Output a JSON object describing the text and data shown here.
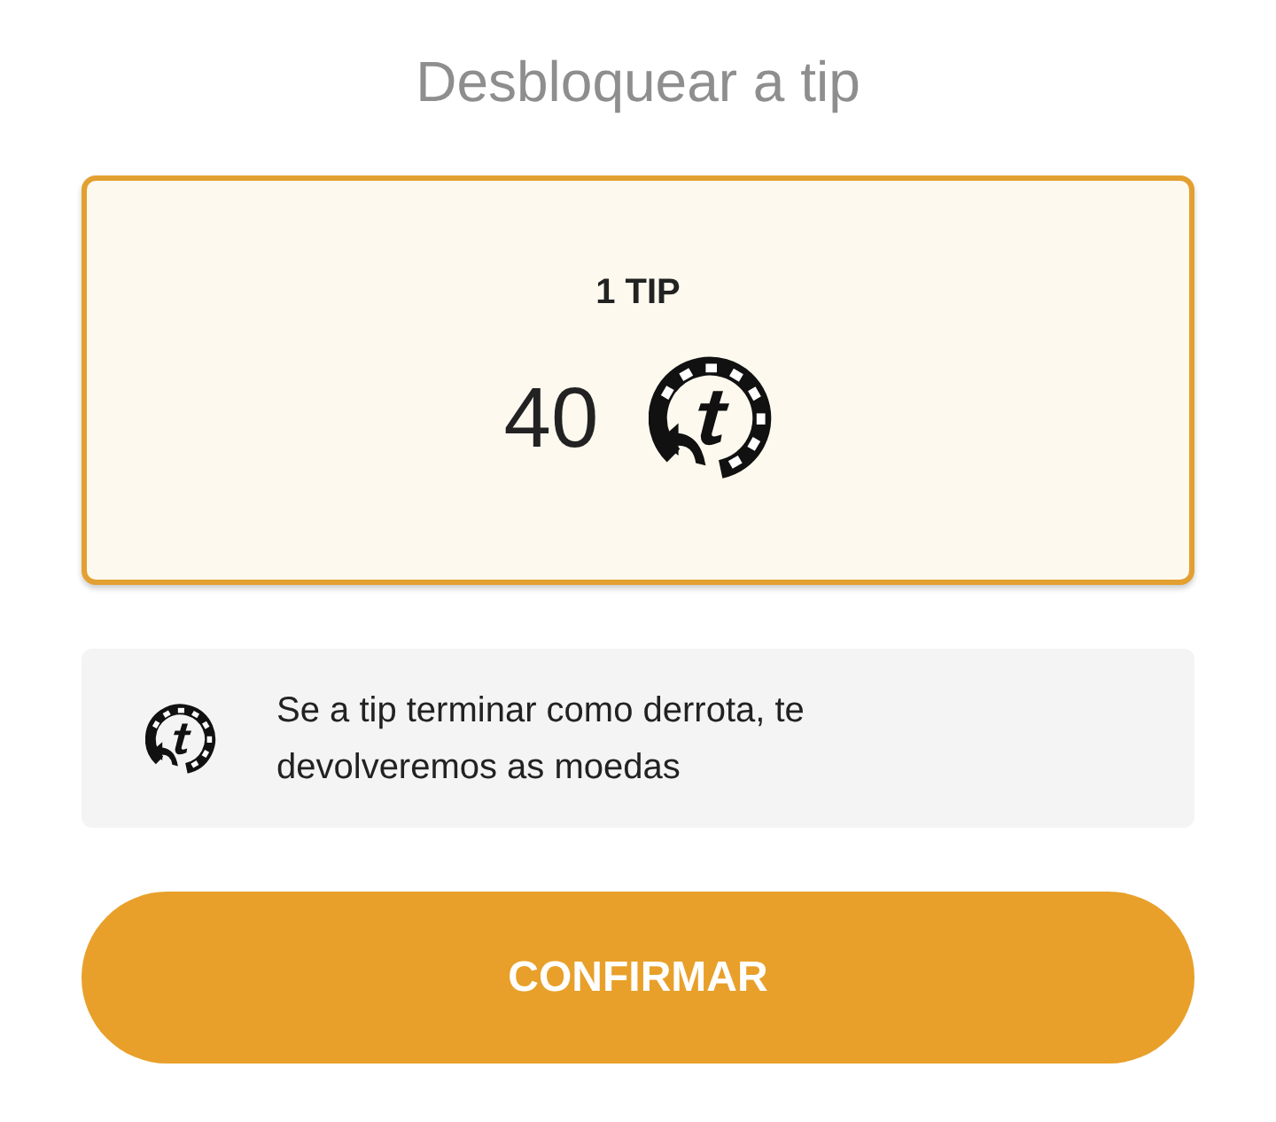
{
  "title": "Desbloquear a tip",
  "offer": {
    "label": "1 TIP",
    "price": "40",
    "selected": true
  },
  "notice": {
    "text": "Se a tip terminar como derrota, te devolveremos as moedas"
  },
  "confirm_button": {
    "label": "CONFIRMAR"
  }
}
